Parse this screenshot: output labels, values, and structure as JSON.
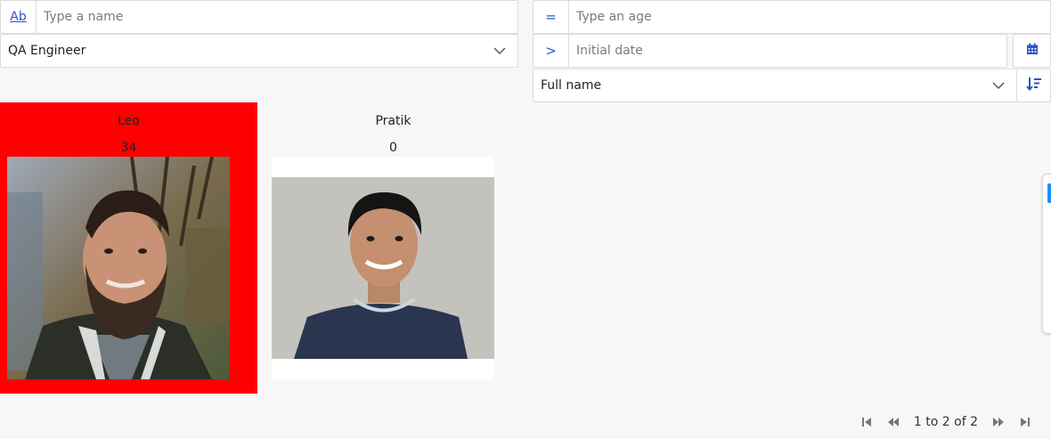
{
  "filters": {
    "name": {
      "prefix": "Ab",
      "placeholder": "Type a name",
      "value": ""
    },
    "role": {
      "value": "QA Engineer"
    },
    "age": {
      "prefix": "=",
      "placeholder": "Type an age",
      "value": ""
    },
    "date": {
      "prefix": ">",
      "placeholder": "Initial date",
      "value": ""
    },
    "sort": {
      "value": "Full name"
    }
  },
  "cards": [
    {
      "name": "Leo",
      "value": "34",
      "highlight": "#ff0000"
    },
    {
      "name": "Pratik",
      "value": "0",
      "highlight": ""
    }
  ],
  "pagination": {
    "label": "1 to 2 of 2"
  },
  "colors": {
    "accent": "#2b56c4",
    "highlight": "#ff0000"
  }
}
